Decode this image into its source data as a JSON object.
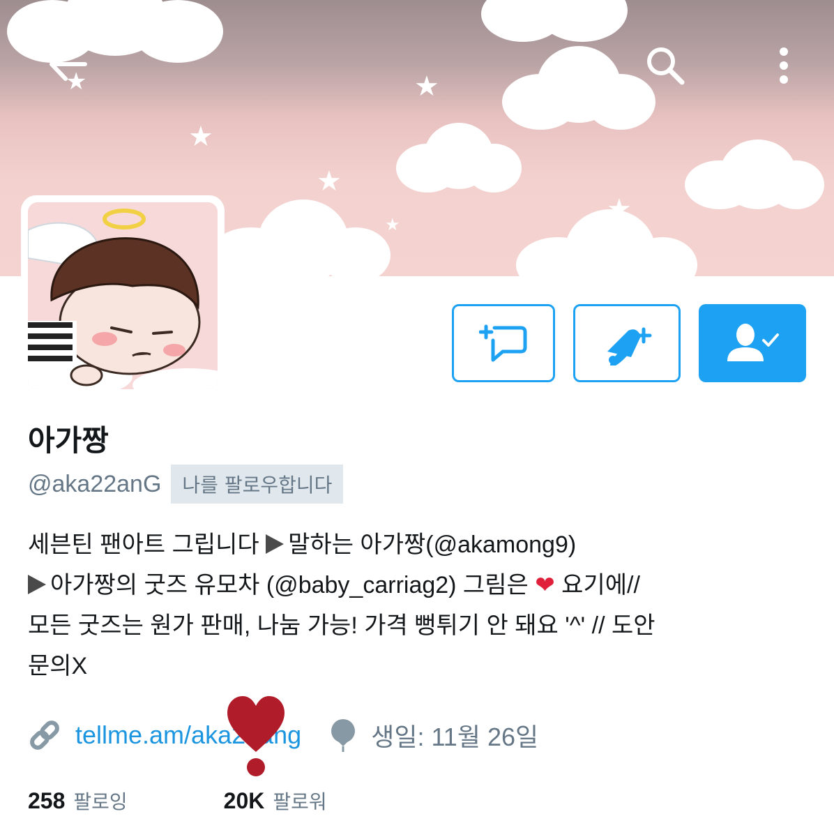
{
  "header": {
    "back_icon": "arrow-left-icon",
    "search_icon": "search-icon",
    "more_icon": "more-vertical-icon"
  },
  "profile": {
    "display_name": "아가짱",
    "handle": "@aka22anG",
    "follows_you_label": "나를 팔로우합니다",
    "bio_lines": [
      {
        "prefix_triangle": false,
        "text": "세븐틴 팬아트 그립니다 ",
        "tri_text": "말하는 아가짱(@akamong9)"
      },
      {
        "text_a": "아가짱의 굿즈 유모차 (@baby_carriag2)   그림은 ",
        "heart": "❤",
        "text_b": " 요기에//"
      },
      {
        "text": "모든 굿즈는 원가 판매, 나눔 가능! 가격 뻥튀기 안 돼요 '^' // 도안"
      },
      {
        "text": "문의X"
      }
    ],
    "link_text": "tellme.am/aka22ang",
    "birthday_text": "생일: 11월 26일",
    "following_count": "258",
    "following_label": "팔로잉",
    "followers_count": "20K",
    "followers_label": "팔로워"
  },
  "actions": {
    "dm_icon": "direct-message-icon",
    "notify_icon": "bell-plus-icon",
    "following_icon": "user-check-icon"
  },
  "colors": {
    "accent": "#1da1f2",
    "link": "#1b95e0",
    "secondary_text": "#657786",
    "banner_pink": "#f4d3d1",
    "annotation_red": "#b01c2a"
  }
}
